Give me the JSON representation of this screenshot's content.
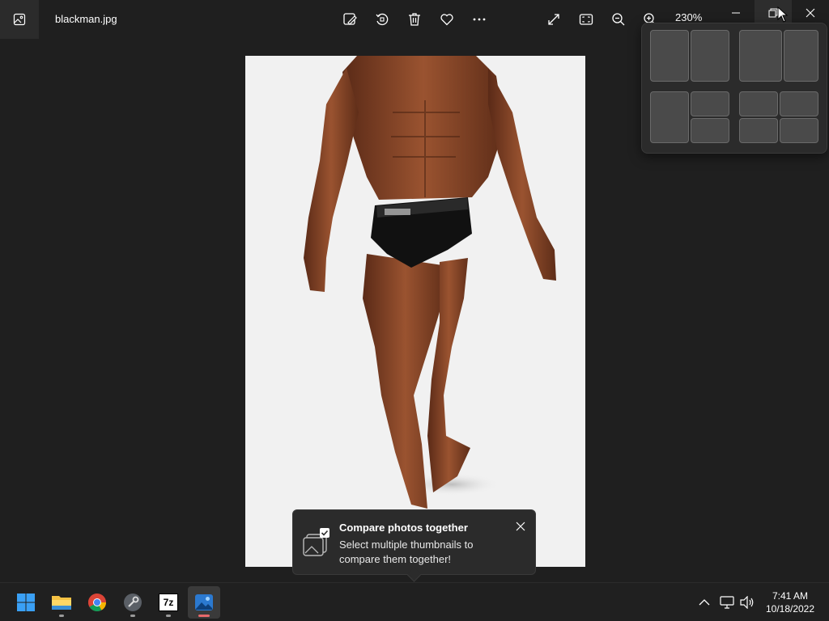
{
  "app": {
    "filename": "blackman.jpg",
    "zoom_level": "230%"
  },
  "toolbar": {
    "buttons": [
      "edit-image-icon",
      "rotate-icon",
      "delete-icon",
      "favorite-icon",
      "more-icon"
    ],
    "right_buttons": [
      "expand-icon",
      "fit-to-window-icon",
      "zoom-out-icon",
      "zoom-in-icon"
    ]
  },
  "window_controls": [
    "minimize-icon",
    "maximize-icon",
    "close-icon"
  ],
  "snap_layouts": {
    "layouts": [
      "two-equal-columns",
      "two-columns-wide-left",
      "main-left-two-stacked-right",
      "four-quadrants"
    ]
  },
  "toast": {
    "title": "Compare photos together",
    "body": "Select multiple thumbnails to compare them together!"
  },
  "taskbar": {
    "apps": [
      "start-icon",
      "file-explorer-icon",
      "chrome-icon",
      "settings-tool-icon",
      "7zip-icon",
      "photos-icon"
    ],
    "seven_zip_label": "7z",
    "active_app": "photos-icon"
  },
  "tray": {
    "time": "7:41 AM",
    "date": "10/18/2022"
  },
  "colors": {
    "background": "#1f1f1f",
    "toast_bg": "#2b2b2b",
    "active_indicator": "#e8696b",
    "photo_bg": "#f1f1f1"
  }
}
